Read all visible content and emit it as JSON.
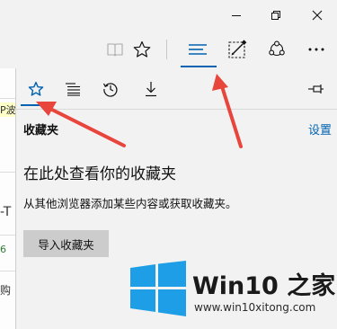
{
  "hub": {
    "tabs": [
      {
        "icon": "star-icon",
        "selected": true
      },
      {
        "icon": "reading-list-icon",
        "selected": false
      },
      {
        "icon": "history-icon",
        "selected": false
      },
      {
        "icon": "download-icon",
        "selected": false
      }
    ],
    "section_title": "收藏夹",
    "settings_link": "设置",
    "empty_heading": "在此处查看你的收藏夹",
    "empty_description": "从其他浏览器添加某些内容或获取收藏夹。",
    "import_button": "导入收藏夹"
  },
  "background_page": {
    "fragments": [
      "P波",
      "-T",
      "6",
      "购"
    ]
  },
  "watermark": {
    "brand": "Win10 之家",
    "url": "www.win10xitong.com"
  },
  "colors": {
    "accent": "#0063b1",
    "annotation": "#e8463c",
    "watermark_blue": "#1e9ee6"
  }
}
